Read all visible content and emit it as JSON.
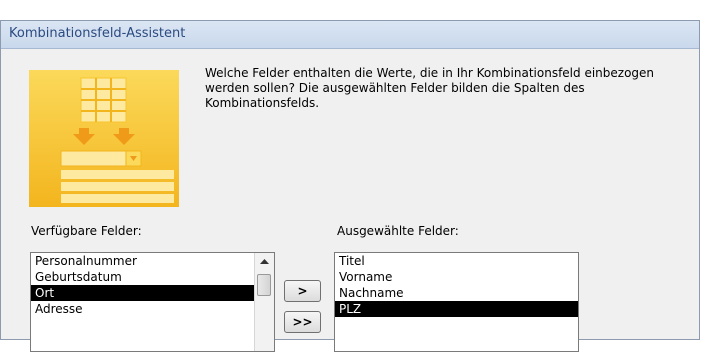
{
  "window": {
    "title": "Kombinationsfeld-Assistent"
  },
  "instructions": "Welche Felder enthalten die Werte, die in Ihr Kombinationsfeld einbezogen werden sollen? Die ausgewählten Felder bilden die Spalten des Kombinationsfelds.",
  "available": {
    "label": "Verfügbare Felder:",
    "items": [
      "Personalnummer",
      "Geburtsdatum",
      "Ort",
      "Adresse"
    ],
    "selected_item": "Ort"
  },
  "selected": {
    "label": "Ausgewählte Felder:",
    "items": [
      "Titel",
      "Vorname",
      "Nachname",
      "PLZ"
    ],
    "selected_item": "PLZ"
  },
  "buttons": {
    "move_one": ">",
    "move_all": ">>"
  }
}
